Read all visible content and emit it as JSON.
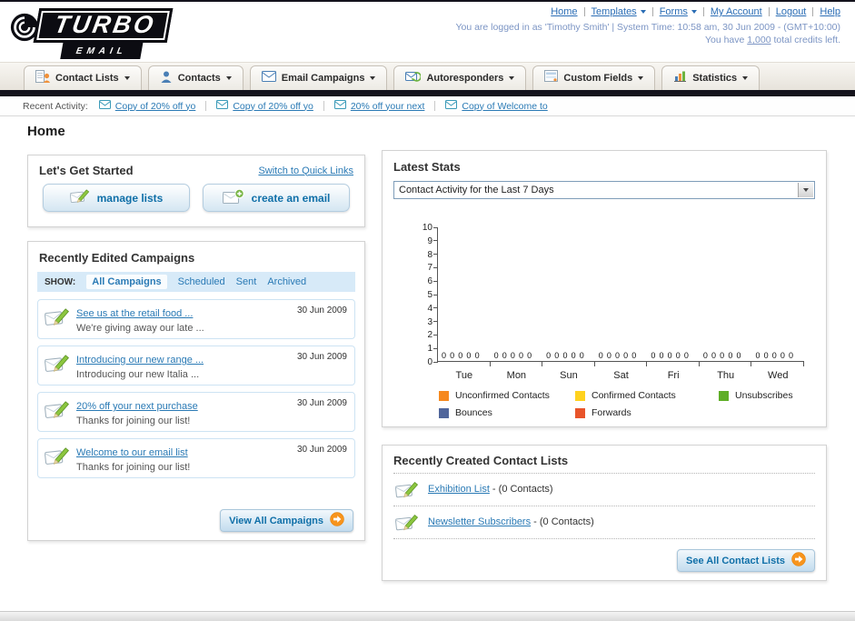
{
  "page": {
    "title": "Home"
  },
  "header": {
    "logo_line1": "TURBO",
    "logo_line2": "EMAIL",
    "nav": [
      {
        "label": "Home"
      },
      {
        "label": "Templates"
      },
      {
        "label": "Forms"
      },
      {
        "label": "My Account"
      },
      {
        "label": "Logout"
      },
      {
        "label": "Help"
      }
    ],
    "login_line": "You are logged in as 'Timothy Smith' | System Time: 10:58 am, 30 Jun 2009 - (GMT+10:00)",
    "credits_prefix": "You have ",
    "credits_value": "1,000",
    "credits_suffix": " total credits left."
  },
  "tabs": [
    {
      "label": "Contact Lists"
    },
    {
      "label": "Contacts"
    },
    {
      "label": "Email Campaigns"
    },
    {
      "label": "Autoresponders"
    },
    {
      "label": "Custom Fields"
    },
    {
      "label": "Statistics"
    }
  ],
  "recent_activity": {
    "label": "Recent Activity:",
    "items": [
      {
        "label": "Copy of 20% off yo"
      },
      {
        "label": "Copy of 20% off yo"
      },
      {
        "label": "20% off your next"
      },
      {
        "label": "Copy of Welcome to"
      }
    ]
  },
  "get_started": {
    "title": "Let's Get Started",
    "switch_link": "Switch to Quick Links",
    "manage_lists_label": "manage lists",
    "create_email_label": "create an email"
  },
  "campaigns": {
    "title": "Recently Edited Campaigns",
    "show_label": "SHOW:",
    "filters": [
      {
        "label": "All Campaigns",
        "active": true
      },
      {
        "label": "Scheduled",
        "active": false
      },
      {
        "label": "Sent",
        "active": false
      },
      {
        "label": "Archived",
        "active": false
      }
    ],
    "items": [
      {
        "title": "See us at the retail food ...",
        "subtitle": "We're giving away our late ...",
        "date": "30 Jun 2009"
      },
      {
        "title": "Introducing our new range ...",
        "subtitle": "Introducing our new Italia ...",
        "date": "30 Jun 2009"
      },
      {
        "title": "20% off your next purchase",
        "subtitle": "Thanks for joining our list!",
        "date": "30 Jun 2009"
      },
      {
        "title": "Welcome to our email list",
        "subtitle": "Thanks for joining our list!",
        "date": "30 Jun 2009"
      }
    ],
    "view_all_label": "View All Campaigns"
  },
  "stats": {
    "title": "Latest Stats",
    "dropdown_value": "Contact Activity for the Last 7 Days",
    "chart_data": {
      "type": "bar",
      "title": "Contact Activity for the Last 7 Days",
      "categories": [
        "Tue",
        "Mon",
        "Sun",
        "Sat",
        "Fri",
        "Thu",
        "Wed"
      ],
      "series": [
        {
          "name": "Unconfirmed Contacts",
          "color": "#f6891f",
          "values": [
            0,
            0,
            0,
            0,
            0,
            0,
            0
          ]
        },
        {
          "name": "Confirmed Contacts",
          "color": "#ffd21e",
          "values": [
            0,
            0,
            0,
            0,
            0,
            0,
            0
          ]
        },
        {
          "name": "Unsubscribes",
          "color": "#5fae27",
          "values": [
            0,
            0,
            0,
            0,
            0,
            0,
            0
          ]
        },
        {
          "name": "Bounces",
          "color": "#51669b",
          "values": [
            0,
            0,
            0,
            0,
            0,
            0,
            0
          ]
        },
        {
          "name": "Forwards",
          "color": "#e8542a",
          "values": [
            0,
            0,
            0,
            0,
            0,
            0,
            0
          ]
        }
      ],
      "xlabel": "",
      "ylabel": "",
      "ylim": [
        0,
        10
      ],
      "ytick_step": 1,
      "grid": false,
      "legend_position": "bottom"
    }
  },
  "contact_lists": {
    "title": "Recently Created Contact Lists",
    "items": [
      {
        "name": "Exhibition List",
        "suffix": " - (0 Contacts)"
      },
      {
        "name": "Newsletter Subscribers",
        "suffix": " - (0 Contacts)"
      }
    ],
    "see_all_label": "See All Contact Lists"
  }
}
